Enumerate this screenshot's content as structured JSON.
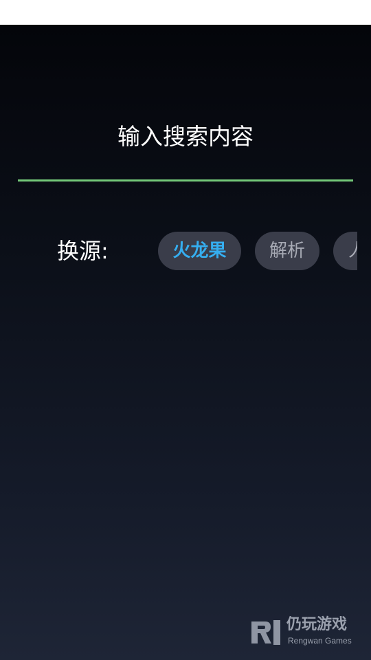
{
  "search": {
    "placeholder": "输入搜索内容",
    "value": "",
    "underline_color": "#74c979"
  },
  "source_switch": {
    "label": "换源:",
    "options": [
      {
        "label": "火龙果",
        "selected": true
      },
      {
        "label": "解析",
        "selected": false
      },
      {
        "label": "人",
        "selected": false
      }
    ],
    "active_color": "#35aef0"
  },
  "watermark": {
    "logo_icon": "rengwan-logo-icon",
    "title": "仍玩游戏",
    "subtitle": "Rengwan Games"
  }
}
